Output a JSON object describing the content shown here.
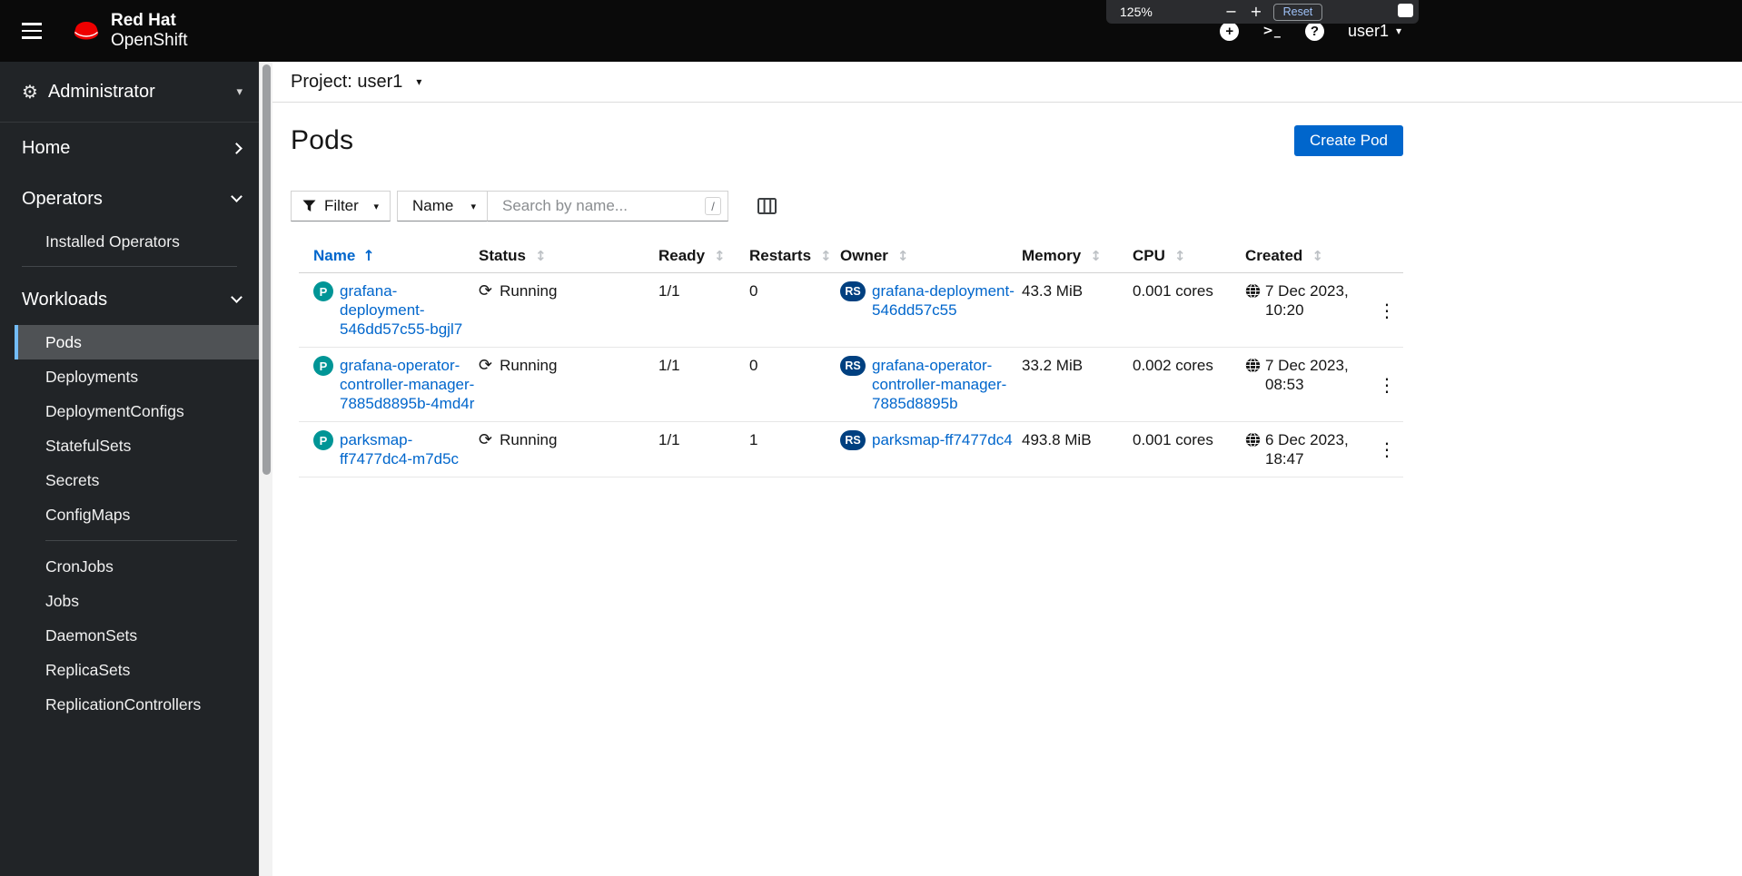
{
  "masthead": {
    "brand_line1": "Red Hat",
    "brand_line2": "OpenShift",
    "user_label": "user1"
  },
  "zoom_popup": {
    "level": "125%",
    "minus": "−",
    "plus": "+",
    "reset": "Reset"
  },
  "sidebar": {
    "perspective": "Administrator",
    "home": "Home",
    "operators": "Operators",
    "installed_operators": "Installed Operators",
    "workloads": "Workloads",
    "workload_items": [
      "Pods",
      "Deployments",
      "DeploymentConfigs",
      "StatefulSets",
      "Secrets",
      "ConfigMaps",
      "CronJobs",
      "Jobs",
      "DaemonSets",
      "ReplicaSets",
      "ReplicationControllers"
    ]
  },
  "project_bar": {
    "label": "Project:",
    "value": "user1"
  },
  "page": {
    "title": "Pods",
    "create_button": "Create Pod"
  },
  "toolbar": {
    "filter_label": "Filter",
    "attribute_selected": "Name",
    "search_placeholder": "Search by name...",
    "shortcut": "/"
  },
  "table": {
    "columns": {
      "name": "Name",
      "status": "Status",
      "ready": "Ready",
      "restarts": "Restarts",
      "owner": "Owner",
      "memory": "Memory",
      "cpu": "CPU",
      "created": "Created"
    },
    "rows": [
      {
        "badge": "P",
        "name": "grafana-deployment-546dd57c55-bgjl7",
        "status": "Running",
        "ready": "1/1",
        "restarts": "0",
        "owner_badge": "RS",
        "owner": "grafana-deployment-546dd57c55",
        "memory": "43.3 MiB",
        "cpu": "0.001 cores",
        "created_date": "7 Dec 2023,",
        "created_time": "10:20"
      },
      {
        "badge": "P",
        "name": "grafana-operator-controller-manager-7885d8895b-4md4r",
        "status": "Running",
        "ready": "1/1",
        "restarts": "0",
        "owner_badge": "RS",
        "owner": "grafana-operator-controller-manager-7885d8895b",
        "memory": "33.2 MiB",
        "cpu": "0.002 cores",
        "created_date": "7 Dec 2023,",
        "created_time": "08:53"
      },
      {
        "badge": "P",
        "name": "parksmap-ff7477dc4-m7d5c",
        "status": "Running",
        "ready": "1/1",
        "restarts": "1",
        "owner_badge": "RS",
        "owner": "parksmap-ff7477dc4",
        "memory": "493.8 MiB",
        "cpu": "0.001 cores",
        "created_date": "6 Dec 2023,",
        "created_time": "18:47"
      }
    ]
  },
  "icons": {
    "gear": "⚙",
    "caret_down": "▾",
    "sort": "↕",
    "sort_asc": "↑",
    "sync": "⟳",
    "kebab": "⋮",
    "plus": "+",
    "help": "?",
    "terminal": ">_"
  },
  "colors": {
    "primary": "#0066cc",
    "pod_badge": "#009596",
    "replicaset_badge": "#004080",
    "nav_active_indicator": "#73bcf7",
    "masthead_bg": "#0a0a0a",
    "sidebar_bg": "#212427",
    "brand_red": "#ee0000"
  }
}
